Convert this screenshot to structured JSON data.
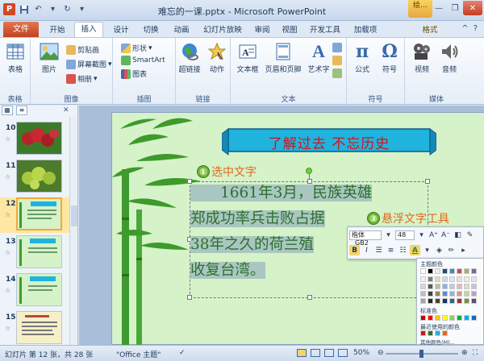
{
  "window": {
    "title": "难忘的一课.pptx - Microsoft PowerPoint",
    "context_tab_group": "绘…"
  },
  "tabs": {
    "file": "文件",
    "items": [
      "开始",
      "插入",
      "设计",
      "切换",
      "动画",
      "幻灯片放映",
      "审阅",
      "视图",
      "开发工具",
      "加载项",
      "格式"
    ],
    "active": "插入"
  },
  "ribbon": {
    "groups": {
      "table": "表格",
      "images": "图像",
      "illustrations": "插图",
      "links": "链接",
      "text": "文本",
      "symbols": "符号",
      "media": "媒体"
    },
    "buttons": {
      "table": "表格",
      "picture": "图片",
      "clipart": "剪贴画",
      "screenshot": "屏幕截图",
      "album": "相册",
      "shapes": "形状",
      "smartart": "SmartArt",
      "chart": "图表",
      "hyperlink": "超链接",
      "action": "动作",
      "textbox": "文本框",
      "header_footer": "页眉和页脚",
      "wordart": "艺术字",
      "equation": "公式",
      "symbol": "符号",
      "video": "视频",
      "audio": "音频"
    }
  },
  "slides_panel": {
    "slides": [
      {
        "number": "10",
        "theme": "fruit-red"
      },
      {
        "number": "11",
        "theme": "fruit-green"
      },
      {
        "number": "12",
        "theme": "bamboo-selected"
      },
      {
        "number": "13",
        "theme": "bamboo"
      },
      {
        "number": "14",
        "theme": "bamboo"
      },
      {
        "number": "15",
        "theme": "text-slide"
      }
    ],
    "selected": "12"
  },
  "slide": {
    "title": "了解过去  不忘历史",
    "body_lines": [
      "　　1661年3月，民族英雄",
      "郑成功率兵击败占据",
      "38年之久的荷兰殖",
      "收复台湾。"
    ]
  },
  "callouts": {
    "one": {
      "num": "①",
      "text": "选中文字"
    },
    "two": {
      "num": "②",
      "text": "悬浮文字工具"
    }
  },
  "mini_toolbar": {
    "font": "楷体_GB2",
    "size": "48",
    "bold": "B",
    "italic": "I",
    "font_color": "A"
  },
  "palette": {
    "theme_label": "主题颜色",
    "standard_label": "标准色",
    "recent_label": "最近使用的颜色",
    "more_label": "其他颜色(M)..."
  },
  "status": {
    "slide_info": "幻灯片 第 12 张，共 28 张",
    "theme": "\"Office 主题\"",
    "zoom": "50%"
  },
  "colors": {
    "accent_orange": "#e06a1d",
    "title_red": "#d2141b",
    "slide_bg": "#d6f2c8",
    "banner": "#1fb3dd"
  }
}
